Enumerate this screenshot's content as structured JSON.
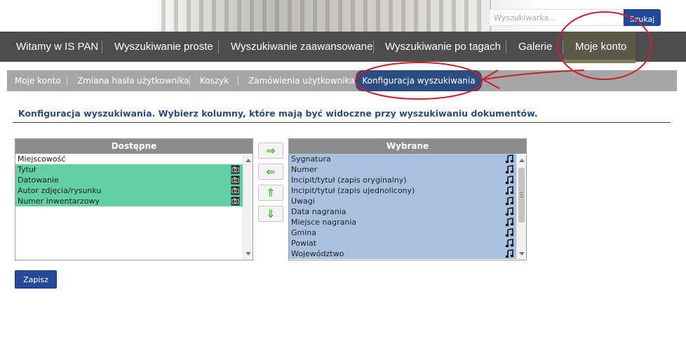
{
  "search": {
    "placeholder": "Wyszukiwarka...",
    "value": "",
    "button_label": "Szukaj"
  },
  "main_nav": [
    "Witamy w IS PAN",
    "Wyszukiwanie proste",
    "Wyszukiwanie zaawansowane",
    "Wyszukiwanie po tagach",
    "Galerie",
    "Moje konto"
  ],
  "sub_nav": [
    "Moje konto",
    "Zmiana hasła użytkownika",
    "Koszyk",
    "Zamówienia użytkownika",
    "Konfiguracja wyszukiwania"
  ],
  "page_title": "Konfiguracja wyszukiwania. Wybierz kolumny, które mają być widoczne przy wyszukiwaniu dokumentów.",
  "available": {
    "header": "Dostępne",
    "items": [
      {
        "label": "Miejscowość",
        "selected": false,
        "icon": ""
      },
      {
        "label": "Tytuł",
        "selected": true,
        "icon": "camera-icon"
      },
      {
        "label": "Datowanie",
        "selected": true,
        "icon": "camera-icon"
      },
      {
        "label": "Autor zdjęcia/rysunku",
        "selected": true,
        "icon": "camera-icon"
      },
      {
        "label": "Numer inwentarzowy",
        "selected": true,
        "icon": "camera-icon"
      }
    ]
  },
  "chosen": {
    "header": "Wybrane",
    "items": [
      {
        "label": "Sygnatura",
        "icon": "music-note-icon"
      },
      {
        "label": "Numer",
        "icon": "music-note-icon"
      },
      {
        "label": "Incipit/tytuł (zapis oryginalny)",
        "icon": "music-note-icon"
      },
      {
        "label": "Incipit/tytuł (zapis ujednolicony)",
        "icon": "music-note-icon"
      },
      {
        "label": "Uwagi",
        "icon": "music-note-icon"
      },
      {
        "label": "Data nagrania",
        "icon": "music-note-icon"
      },
      {
        "label": "Miejsce nagrania",
        "icon": "music-note-icon"
      },
      {
        "label": "Gmina",
        "icon": "music-note-icon"
      },
      {
        "label": "Powiat",
        "icon": "music-note-icon"
      },
      {
        "label": "Województwo",
        "icon": "music-note-icon"
      }
    ]
  },
  "arrow_buttons": [
    {
      "glyph": "⇒",
      "icon": "arrow-right-icon"
    },
    {
      "glyph": "⇐",
      "icon": "arrow-left-icon"
    },
    {
      "glyph": "⇑",
      "icon": "arrow-up-icon"
    },
    {
      "glyph": "⇓",
      "icon": "arrow-down-icon"
    }
  ],
  "save_label": "Zapisz",
  "colors": {
    "nav_bg": "#4d4d4d",
    "subnav_bg": "#a6a6a6",
    "accent": "#2c4d7f",
    "button": "#26489a",
    "selected_row": "#63cfa5",
    "chosen_row": "#aac0df",
    "annotation": "#cc1f2e"
  }
}
